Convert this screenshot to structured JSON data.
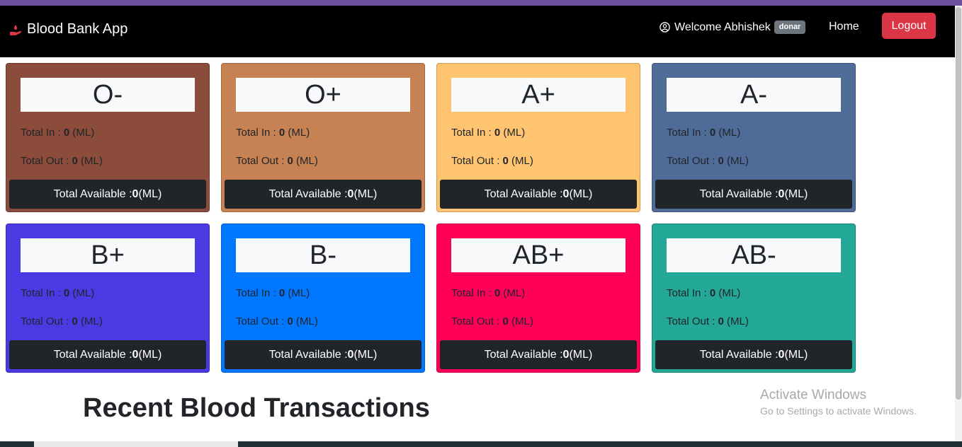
{
  "navbar": {
    "brand": "Blood Bank App",
    "welcome_text": "Welcome Abhishek",
    "role_badge": "donar",
    "home_label": "Home",
    "logout_label": "Logout"
  },
  "cards": [
    {
      "group": "O-",
      "color": "#8b4c3c",
      "total_in": "0",
      "total_out": "0",
      "available": "0"
    },
    {
      "group": "O+",
      "color": "#c68253",
      "total_in": "0",
      "total_out": "0",
      "available": "0"
    },
    {
      "group": "A+",
      "color": "#ffc46f",
      "total_in": "0",
      "total_out": "0",
      "available": "0"
    },
    {
      "group": "A-",
      "color": "#4f6c99",
      "total_in": "0",
      "total_out": "0",
      "available": "0"
    },
    {
      "group": "B+",
      "color": "#4b3ae4",
      "total_in": "0",
      "total_out": "0",
      "available": "0"
    },
    {
      "group": "B-",
      "color": "#0077ff",
      "total_in": "0",
      "total_out": "0",
      "available": "0"
    },
    {
      "group": "AB+",
      "color": "#ff0058",
      "total_in": "0",
      "total_out": "0",
      "available": "0"
    },
    {
      "group": "AB-",
      "color": "#23a796",
      "total_in": "0",
      "total_out": "0",
      "available": "0"
    }
  ],
  "labels": {
    "total_in": "Total In : ",
    "total_out": "Total Out : ",
    "total_available": "Total Available : ",
    "unit": " (ML)"
  },
  "section_title": "Recent Blood Transactions",
  "watermark": {
    "title": "Activate Windows",
    "subtitle": "Go to Settings to activate Windows."
  }
}
